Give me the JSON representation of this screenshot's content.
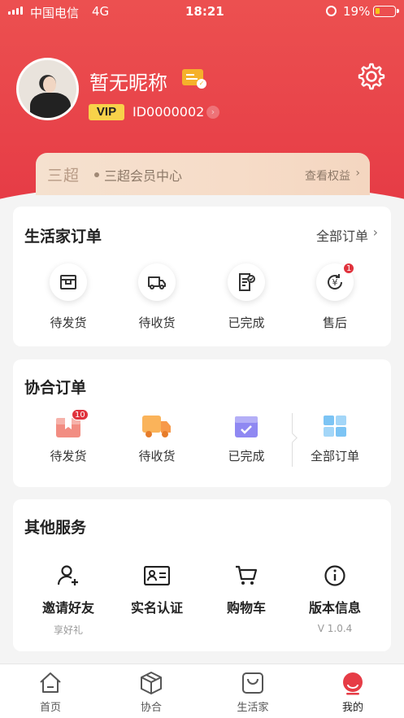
{
  "status_bar": {
    "carrier": "中国电信",
    "network": "4G",
    "time": "18:21",
    "battery": "19%"
  },
  "profile": {
    "nickname": "暂无昵称",
    "vip_label": "VIP",
    "user_id": "ID0000002"
  },
  "member_banner": {
    "logo": "三超",
    "title": "三超会员中心",
    "link": "查看权益"
  },
  "life_orders": {
    "title": "生活家订单",
    "view_all": "全部订单",
    "items": [
      {
        "label": "待发货",
        "icon": "box-icon"
      },
      {
        "label": "待收货",
        "icon": "truck-icon"
      },
      {
        "label": "已完成",
        "icon": "done-doc-icon"
      },
      {
        "label": "售后",
        "icon": "yen-refresh-icon",
        "badge": "1"
      }
    ]
  },
  "coop_orders": {
    "title": "协合订单",
    "items": [
      {
        "label": "待发货",
        "icon": "gift-box-icon",
        "badge": "10"
      },
      {
        "label": "待收货",
        "icon": "truck-icon"
      },
      {
        "label": "已完成",
        "icon": "checked-box-icon"
      },
      {
        "label": "全部订单",
        "icon": "windows-grid-icon"
      }
    ]
  },
  "services": {
    "title": "其他服务",
    "items": [
      {
        "label": "邀请好友",
        "sub": "享好礼",
        "icon": "add-user-icon"
      },
      {
        "label": "实名认证",
        "sub": "",
        "icon": "id-card-icon"
      },
      {
        "label": "购物车",
        "sub": "",
        "icon": "cart-icon"
      },
      {
        "label": "版本信息",
        "sub": "V 1.0.4",
        "icon": "info-icon"
      }
    ]
  },
  "tabbar": {
    "items": [
      {
        "label": "首页",
        "icon": "home-icon"
      },
      {
        "label": "协合",
        "icon": "cube-icon"
      },
      {
        "label": "生活家",
        "icon": "bag-icon"
      },
      {
        "label": "我的",
        "icon": "me-icon",
        "active": true
      }
    ]
  },
  "colors": {
    "primary": "#e63c46",
    "vip": "#f8d24a",
    "badge": "#e0323c"
  }
}
